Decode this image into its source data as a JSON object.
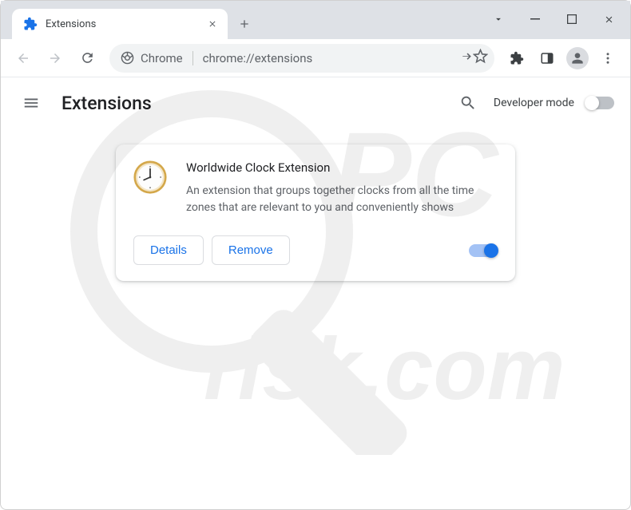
{
  "tab": {
    "title": "Extensions"
  },
  "toolbar": {
    "chip": "Chrome",
    "url": "chrome://extensions"
  },
  "header": {
    "title": "Extensions",
    "developer_mode": "Developer mode"
  },
  "extension": {
    "name": "Worldwide Clock Extension",
    "description": "An extension that groups together clocks from all the time zones that are relevant to you and conveniently shows",
    "details_label": "Details",
    "remove_label": "Remove",
    "enabled": true
  },
  "watermark": {
    "line1": "PC",
    "line2": "risk.com"
  }
}
